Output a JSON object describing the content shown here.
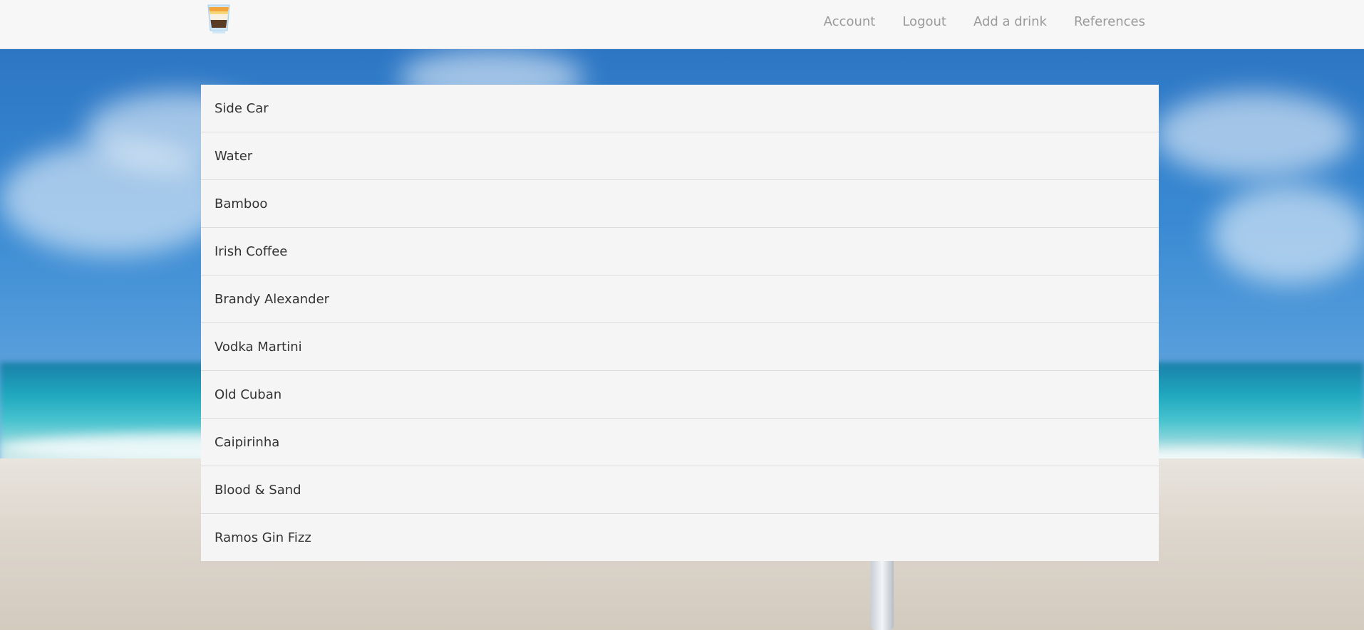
{
  "navbar": {
    "logo": "layered-shot-glass-icon",
    "links": [
      {
        "label": "Account"
      },
      {
        "label": "Logout"
      },
      {
        "label": "Add a drink"
      },
      {
        "label": "References"
      }
    ]
  },
  "drinks": [
    {
      "name": "Side Car"
    },
    {
      "name": "Water"
    },
    {
      "name": "Bamboo"
    },
    {
      "name": "Irish Coffee"
    },
    {
      "name": "Brandy Alexander"
    },
    {
      "name": "Vodka Martini"
    },
    {
      "name": "Old Cuban"
    },
    {
      "name": "Caipirinha"
    },
    {
      "name": "Blood & Sand"
    },
    {
      "name": "Ramos Gin Fizz"
    }
  ],
  "colors": {
    "navbar_bg": "#f7f7f7",
    "nav_link": "#9a9a9a",
    "list_bg": "#f5f5f5",
    "list_text": "#333333"
  }
}
